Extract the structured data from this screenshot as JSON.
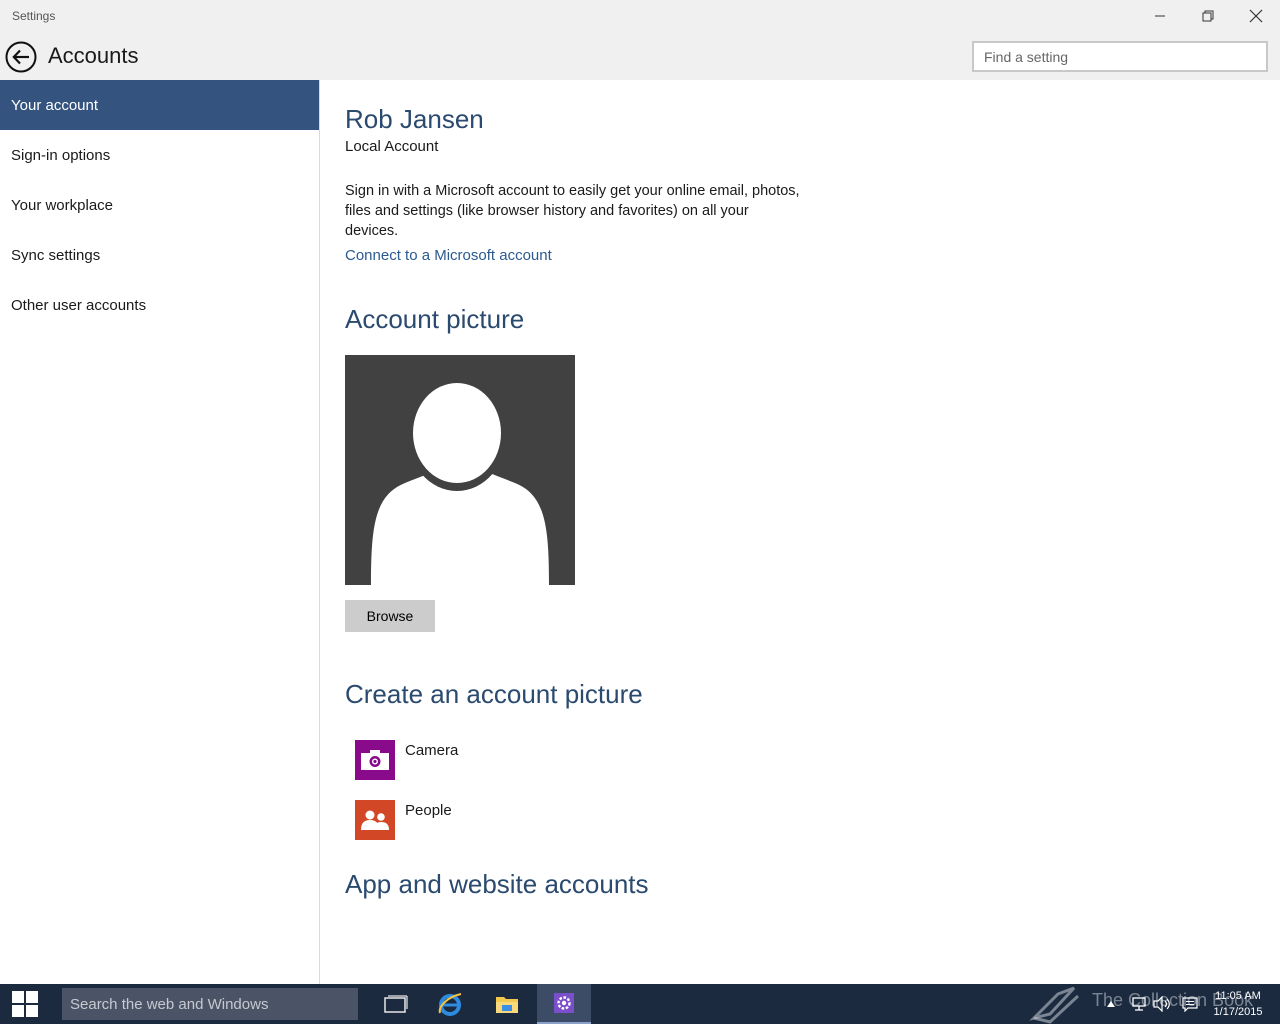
{
  "window": {
    "title": "Settings"
  },
  "header": {
    "page_title": "Accounts",
    "search_placeholder": "Find a setting"
  },
  "sidebar": {
    "items": [
      {
        "label": "Your account",
        "active": true
      },
      {
        "label": "Sign-in options",
        "active": false
      },
      {
        "label": "Your workplace",
        "active": false
      },
      {
        "label": "Sync settings",
        "active": false
      },
      {
        "label": "Other user accounts",
        "active": false
      }
    ]
  },
  "account": {
    "name": "Rob Jansen",
    "type": "Local Account",
    "description": "Sign in with a Microsoft account to easily get your online email, photos, files and settings (like browser history and favorites) on all your devices.",
    "connect_link": "Connect to a Microsoft account"
  },
  "picture": {
    "heading": "Account picture",
    "browse_label": "Browse"
  },
  "create": {
    "heading": "Create an account picture",
    "options": [
      {
        "label": "Camera",
        "icon": "camera-icon",
        "color": "#8a0a8c"
      },
      {
        "label": "People",
        "icon": "people-icon",
        "color": "#d24726"
      }
    ]
  },
  "apps": {
    "heading": "App and website accounts"
  },
  "taskbar": {
    "search_placeholder": "Search the web and Windows",
    "watermark": "The Collection Book",
    "time": "11:05 AM",
    "date": "1/17/2015"
  },
  "colors": {
    "accent": "#34537e",
    "heading": "#2b4a6f",
    "link": "#2b5a8e",
    "taskbar": "#1b2a3f"
  }
}
